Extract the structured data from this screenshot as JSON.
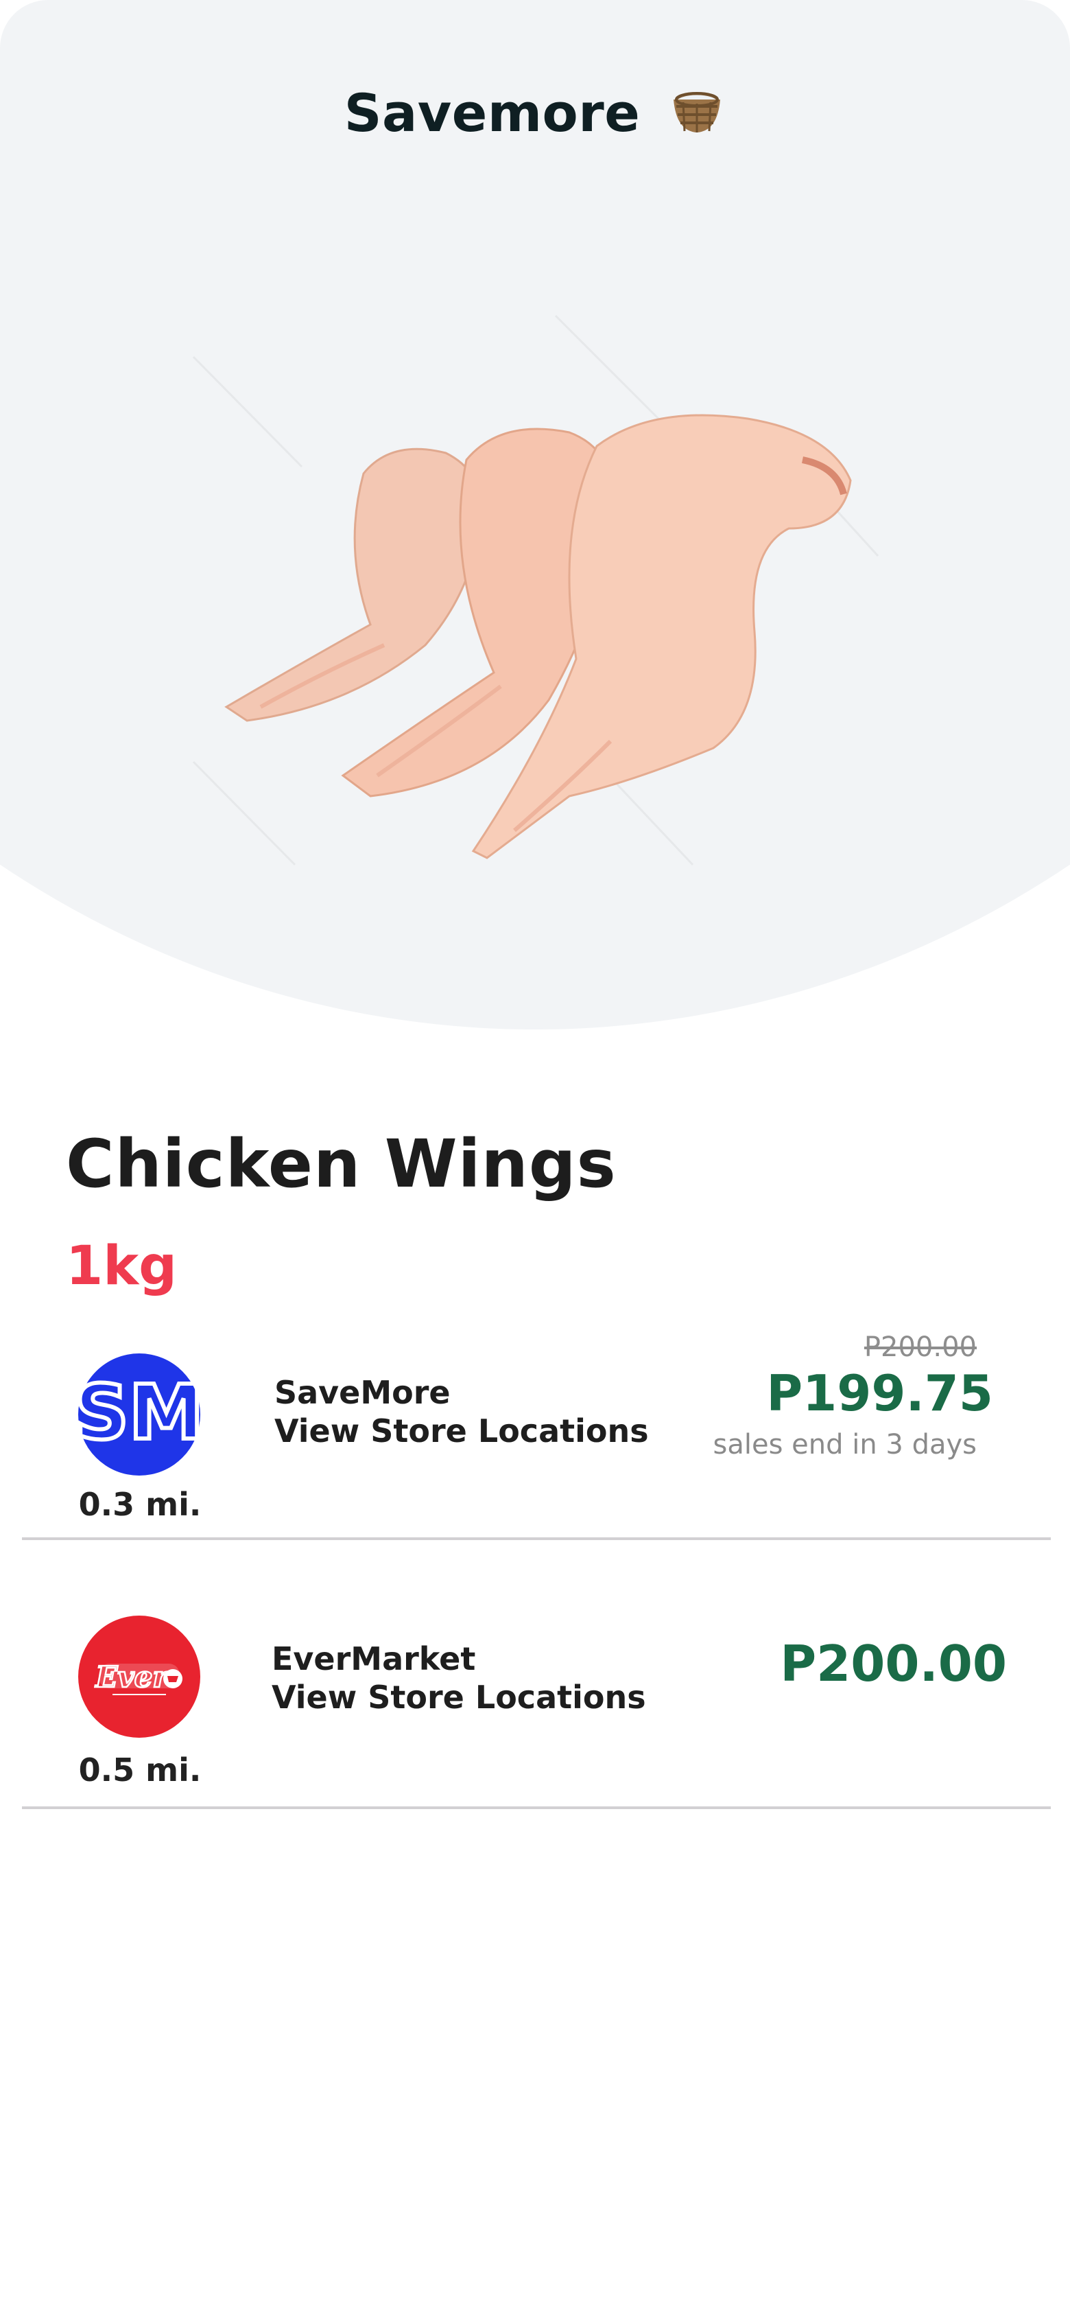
{
  "header": {
    "title": "Savemore",
    "title_icon": "basket-icon"
  },
  "product": {
    "name": "Chicken Wings",
    "size": "1kg",
    "image_icon": "chicken-wings-image"
  },
  "stores": [
    {
      "name": "SaveMore",
      "link_label": "View Store Locations",
      "distance": "0.3 mi.",
      "old_price": "P200.00",
      "price": "P199.75",
      "sale_note": "sales end in 3 days",
      "logo_icon": "savemore-logo-icon",
      "logo_color": "#1f35e8"
    },
    {
      "name": "EverMarket",
      "link_label": "View Store Locations",
      "distance": "0.5 mi.",
      "price": "P200.00",
      "logo_icon": "evermarket-logo-icon",
      "logo_color": "#e8232f"
    }
  ],
  "colors": {
    "hero_bg": "#f2f4f6",
    "price_green": "#1a6b47",
    "size_red": "#ef3b4f"
  }
}
